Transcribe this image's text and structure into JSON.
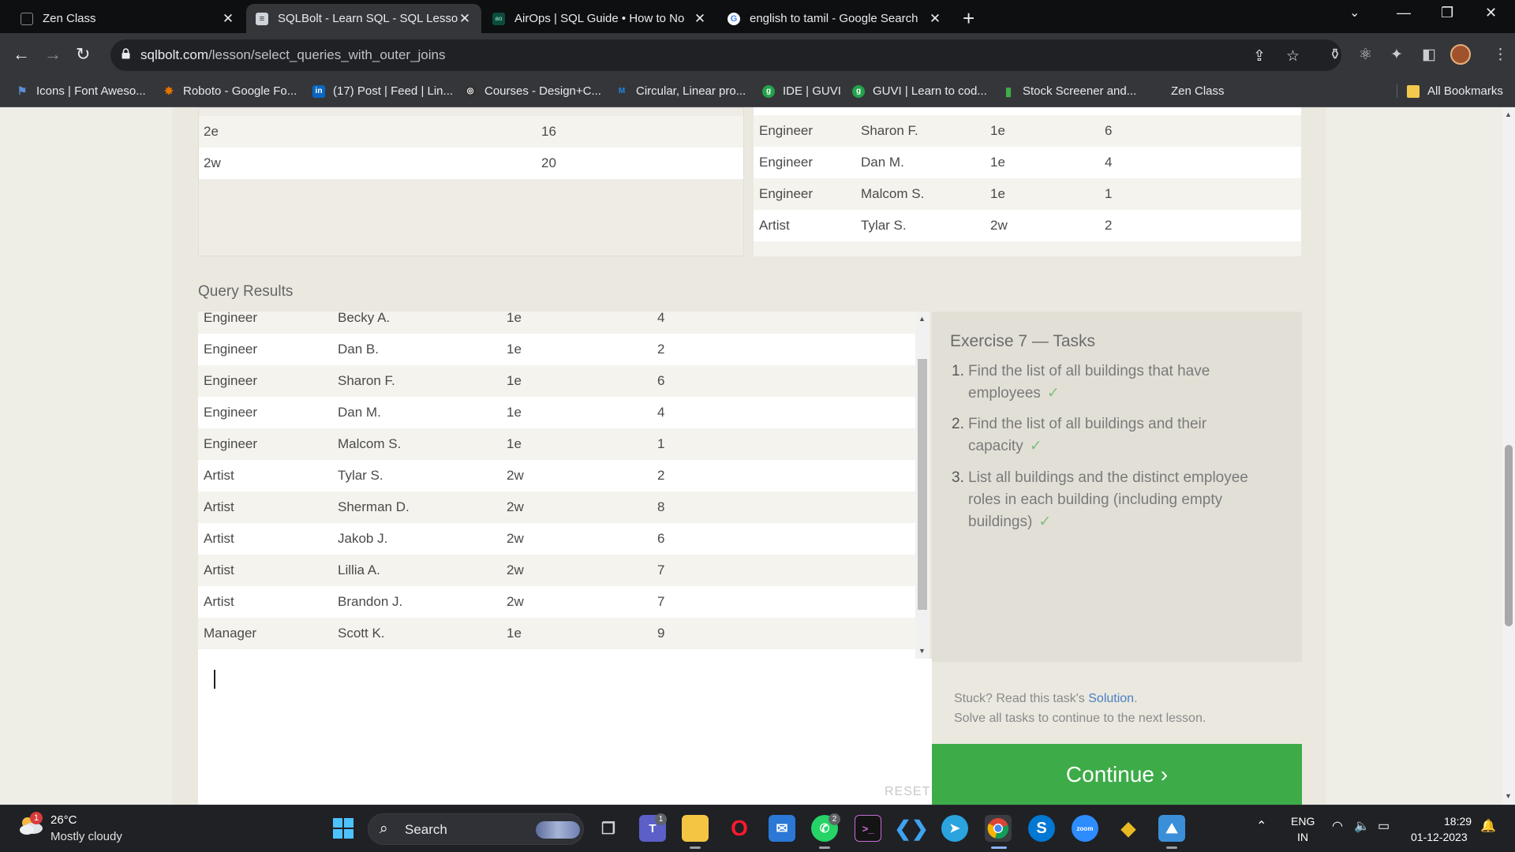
{
  "tabs": [
    {
      "title": "Zen Class",
      "icon": "zen-class-icon"
    },
    {
      "title": "SQLBolt - Learn SQL - SQL Lesso",
      "icon": "sqlbolt-icon"
    },
    {
      "title": "AirOps | SQL Guide • How to No",
      "icon": "airops-icon"
    },
    {
      "title": "english to tamil - Google Search",
      "icon": "google-icon"
    }
  ],
  "address": {
    "host": "sqlbolt.com",
    "path": "/lesson/select_queries_with_outer_joins"
  },
  "bookmarks": [
    {
      "label": "Icons | Font Aweso...",
      "color": "#5b8fd9",
      "glyph": "⚑"
    },
    {
      "label": "Roboto - Google Fo...",
      "color": "#e37400",
      "glyph": "✸"
    },
    {
      "label": "(17) Post | Feed | Lin...",
      "color": "#0a66c2",
      "glyph": "in"
    },
    {
      "label": "Courses - Design+C...",
      "color": "#222222",
      "glyph": "◎"
    },
    {
      "label": "Circular, Linear pro...",
      "color": "#1e88e5",
      "glyph": "M"
    },
    {
      "label": "IDE | GUVI",
      "color": "#22a34a",
      "glyph": "g"
    },
    {
      "label": "GUVI | Learn to cod...",
      "color": "#22a34a",
      "glyph": "g"
    },
    {
      "label": "Stock Screener and...",
      "color": "#3fae49",
      "glyph": "▮"
    },
    {
      "label": "Zen Class",
      "color": "#555555",
      "glyph": "▭"
    }
  ],
  "all_bookmarks": "All Bookmarks",
  "top_left_rows": [
    {
      "building": "2e",
      "capacity": "16"
    },
    {
      "building": "2w",
      "capacity": "20"
    }
  ],
  "top_right_rows": [
    {
      "role": "Engineer",
      "name": "Sharon F.",
      "building": "1e",
      "years": "6"
    },
    {
      "role": "Engineer",
      "name": "Dan M.",
      "building": "1e",
      "years": "4"
    },
    {
      "role": "Engineer",
      "name": "Malcom S.",
      "building": "1e",
      "years": "1"
    },
    {
      "role": "Artist",
      "name": "Tylar S.",
      "building": "2w",
      "years": "2"
    }
  ],
  "query_results_label": "Query Results",
  "results_rows": [
    {
      "role": "Engineer",
      "name": "Becky A.",
      "building": "1e",
      "years": "4"
    },
    {
      "role": "Engineer",
      "name": "Dan B.",
      "building": "1e",
      "years": "2"
    },
    {
      "role": "Engineer",
      "name": "Sharon F.",
      "building": "1e",
      "years": "6"
    },
    {
      "role": "Engineer",
      "name": "Dan M.",
      "building": "1e",
      "years": "4"
    },
    {
      "role": "Engineer",
      "name": "Malcom S.",
      "building": "1e",
      "years": "1"
    },
    {
      "role": "Artist",
      "name": "Tylar S.",
      "building": "2w",
      "years": "2"
    },
    {
      "role": "Artist",
      "name": "Sherman D.",
      "building": "2w",
      "years": "8"
    },
    {
      "role": "Artist",
      "name": "Jakob J.",
      "building": "2w",
      "years": "6"
    },
    {
      "role": "Artist",
      "name": "Lillia A.",
      "building": "2w",
      "years": "7"
    },
    {
      "role": "Artist",
      "name": "Brandon J.",
      "building": "2w",
      "years": "7"
    },
    {
      "role": "Manager",
      "name": "Scott K.",
      "building": "1e",
      "years": "9"
    }
  ],
  "editor": {
    "reset_label": "RESET"
  },
  "exercise": {
    "title": "Exercise 7 — Tasks",
    "tasks": [
      {
        "num": "1.",
        "text": "Find the list of all buildings that have employees",
        "check": "✓"
      },
      {
        "num": "2.",
        "text": "Find the list of all buildings and their capacity",
        "check": "✓"
      },
      {
        "num": "3.",
        "text": "List all buildings and the distinct employee roles in each building (including empty buildings)",
        "check": "✓"
      }
    ],
    "stuck_prefix": "Stuck? Read this task's ",
    "solution_link": "Solution",
    "stuck_suffix": ".",
    "solve_all": "Solve all tasks to continue to the next lesson.",
    "continue_label": "Continue ›"
  },
  "taskbar": {
    "weather_temp": "26°C",
    "weather_desc": "Mostly cloudy",
    "weather_badge": "1",
    "search_label": "Search",
    "teams_badge": "1",
    "whatsapp_badge": "2",
    "lang_line1": "ENG",
    "lang_line2": "IN",
    "time": "18:29",
    "date": "01-12-2023"
  }
}
